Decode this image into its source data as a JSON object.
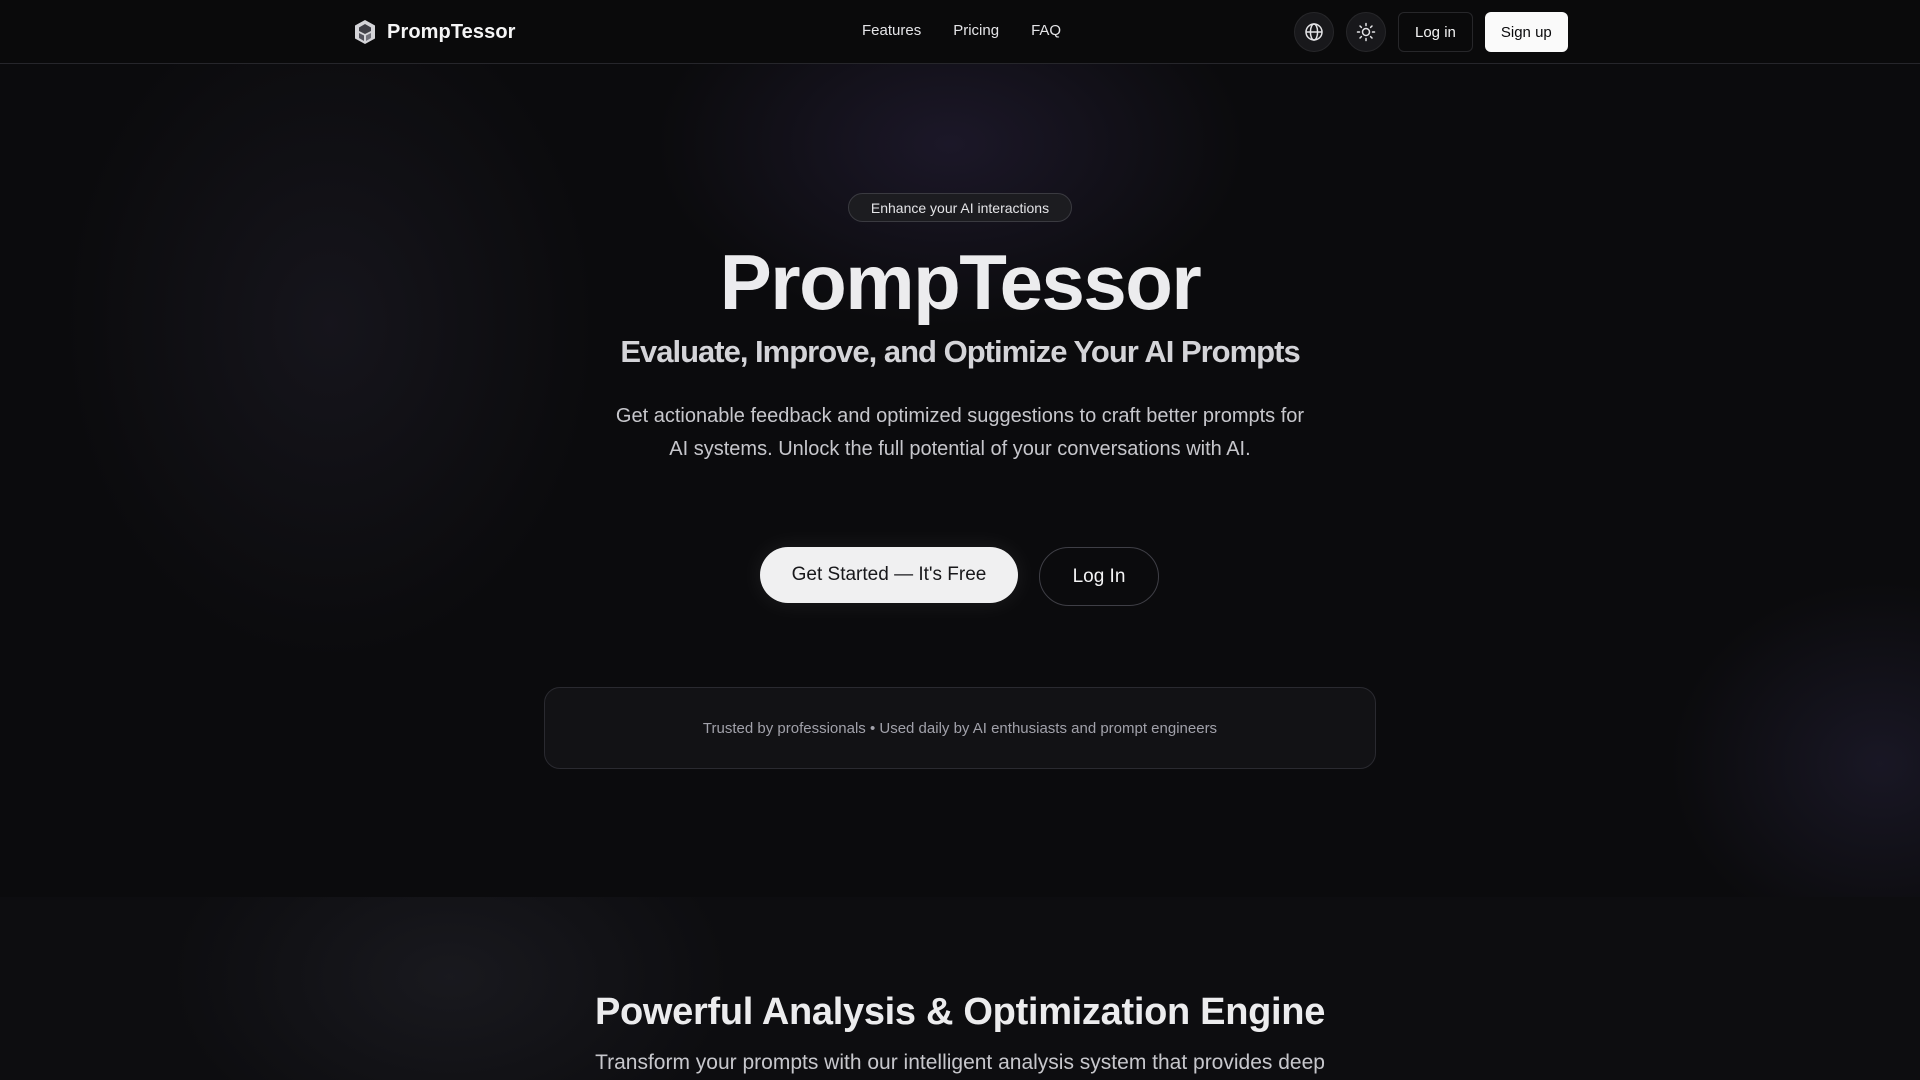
{
  "header": {
    "brand_name": "PrompTessor",
    "nav": [
      "Features",
      "Pricing",
      "FAQ"
    ],
    "icons": [
      "globe-icon",
      "sun-icon"
    ],
    "login_label": "Log in",
    "signup_label": "Sign up"
  },
  "hero": {
    "badge": "Enhance your AI interactions",
    "title": "PrompTessor",
    "subtitle": "Evaluate, Improve, and Optimize Your AI Prompts",
    "description": "Get actionable feedback and optimized suggestions to craft better prompts for AI systems. Unlock the full potential of your conversations with AI.",
    "cta_primary": "Get Started — It's Free",
    "cta_secondary": "Log In",
    "trust_text": "Trusted by professionals • Used daily by AI enthusiasts and prompt engineers"
  },
  "features": {
    "title": "Powerful Analysis & Optimization Engine",
    "description": "Transform your prompts with our intelligent analysis system that provides deep"
  },
  "colors": {
    "background": "#0a0a0b",
    "text": "#f4f4f5",
    "muted": "#a1a1aa",
    "button_light": "#fafafa"
  }
}
